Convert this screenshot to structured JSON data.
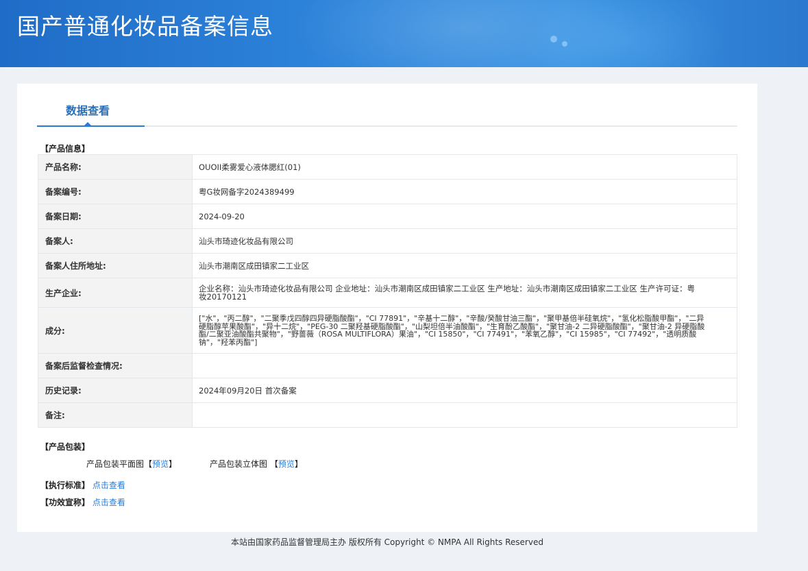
{
  "banner": {
    "title": "国产普通化妆品备案信息"
  },
  "tabs": {
    "active_label": "数据查看"
  },
  "product_info": {
    "section_title": "【产品信息】",
    "rows": [
      {
        "label": "产品名称:",
        "value": "OUOII柔雾爱心液体腮红(01)"
      },
      {
        "label": "备案编号:",
        "value": "粤G妆网备字2024389499"
      },
      {
        "label": "备案日期:",
        "value": "2024-09-20"
      },
      {
        "label": "备案人:",
        "value": "汕头市琦迹化妆品有限公司"
      },
      {
        "label": "备案人住所地址:",
        "value": "汕头市潮南区成田镇家二工业区"
      },
      {
        "label": "生产企业:",
        "value": "企业名称：汕头市琦迹化妆品有限公司 企业地址：汕头市潮南区成田镇家二工业区 生产地址：汕头市潮南区成田镇家二工业区 生产许可证：粤妆20170121"
      },
      {
        "label": "成分:",
        "value": "[\"水\"，\"丙二醇\"，\"二聚季戊四醇四异硬脂酸酯\"，\"CI 77891\"，\"辛基十二醇\"，\"辛酸/癸酸甘油三酯\"，\"聚甲基倍半硅氧烷\"，\"氢化松脂酸甲酯\"，\"二异硬脂醇苹果酸酯\"，\"异十二烷\"，\"PEG-30 二聚羟基硬脂酸酯\"，\"山梨坦倍半油酸酯\"，\"生育酚乙酸酯\"，\"聚甘油-2 二异硬脂酸酯\"，\"聚甘油-2 异硬脂酸酯/二聚亚油酸酯共聚物\"，\"野蔷薇（ROSA MULTIFLORA）果油\"，\"CI 15850\"，\"CI 77491\"，\"苯氧乙醇\"，\"CI 15985\"，\"CI 77492\"，\"透明质酸钠\"，\"羟苯丙酯\"]"
      },
      {
        "label": "备案后监督检查情况:",
        "value": ""
      },
      {
        "label": "历史记录:",
        "value": "2024年09月20日 首次备案"
      },
      {
        "label": "备注:",
        "value": ""
      }
    ]
  },
  "packaging": {
    "section_title": "【产品包装】",
    "flat_label": "产品包装平面图",
    "flat_link": "预览",
    "solid_label": "产品包装立体图",
    "solid_link": "预览"
  },
  "standard": {
    "section_title": "【执行标准】",
    "link": "点击查看"
  },
  "efficacy": {
    "section_title": "【功效宣称】",
    "link": "点击查看"
  },
  "footer": {
    "text": "本站由国家药品监督管理局主办 版权所有 Copyright © NMPA All Rights Reserved"
  }
}
